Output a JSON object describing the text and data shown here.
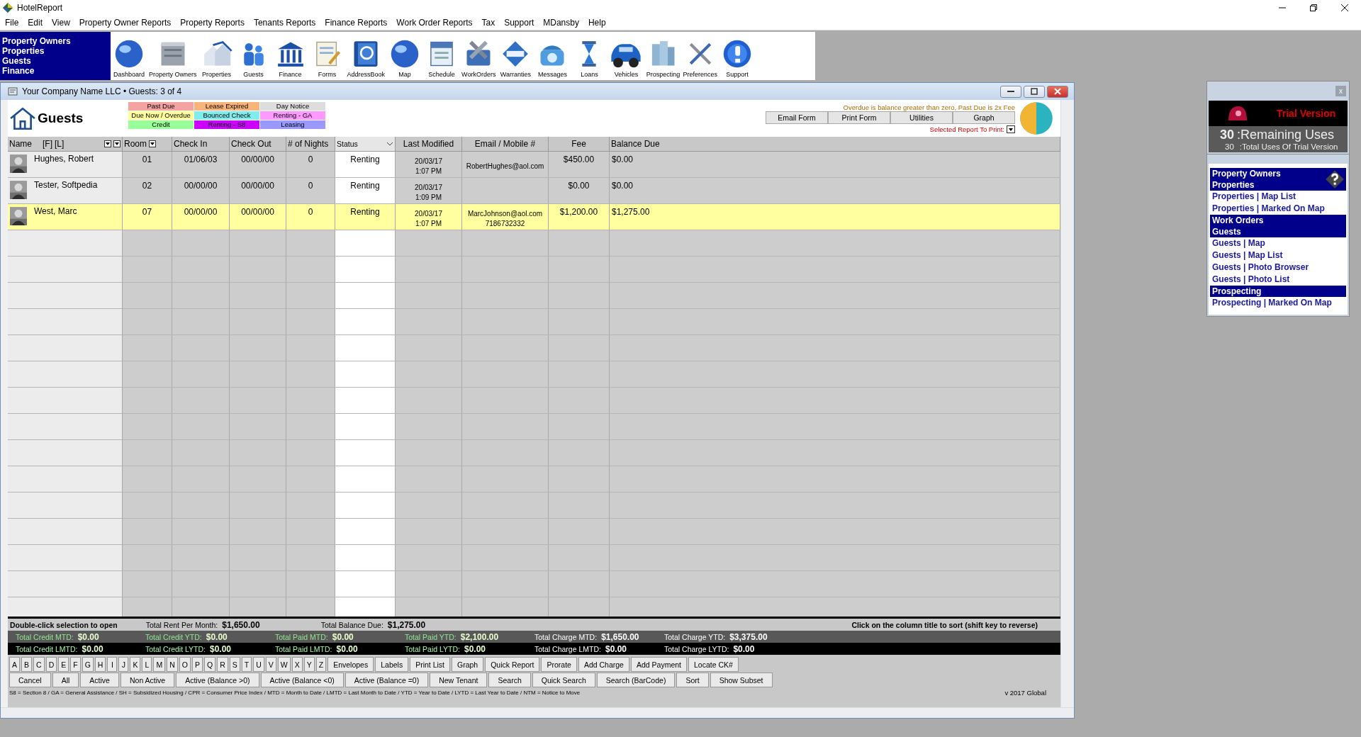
{
  "app_window": {
    "title": "HotelReport"
  },
  "menu": [
    "File",
    "Edit",
    "View",
    "Property Owner Reports",
    "Property Reports",
    "Tenants Reports",
    "Finance Reports",
    "Work Order Reports",
    "Tax",
    "Support",
    "MDansby",
    "Help"
  ],
  "toolbar": {
    "side_links": [
      "Property Owners",
      "Properties",
      "Guests",
      "Finance"
    ],
    "buttons": [
      "Dashboard",
      "Property Owners",
      "Properties",
      "Guests",
      "Finance",
      "Forms",
      "AddressBook",
      "Map",
      "Schedule",
      "WorkOrders",
      "Warranties",
      "Messages",
      "Loans",
      "Vehicles",
      "Prospecting",
      "Preferences",
      "Support"
    ]
  },
  "guests_window": {
    "title": "Your Company Name LLC  •  Guests: 3 of 4",
    "heading": "Guests",
    "legend": [
      {
        "label": "Past Due",
        "color": "#f4a3a3"
      },
      {
        "label": "Lease Expired",
        "color": "#f8b47a"
      },
      {
        "label": "Day Notice",
        "color": "#dddddd"
      },
      {
        "label": "Due Now / Overdue",
        "color": "#ffff99"
      },
      {
        "label": "Bounced Check",
        "color": "#80ecec"
      },
      {
        "label": "Renting - GA",
        "color": "#ff99ff"
      },
      {
        "label": "Credit",
        "color": "#99ff99"
      },
      {
        "label": "Renting - S8",
        "color": "#cc00ff"
      },
      {
        "label": "Leasing",
        "color": "#9999ff"
      }
    ],
    "note": "Overdue is balance greater than zero, Past Due is 2x Fee",
    "actions": [
      "Email Form",
      "Print Form",
      "Utilities",
      "Graph"
    ],
    "report_label": "Selected Report To Print:",
    "columns": {
      "name": "Name",
      "first": "[F]",
      "last": "[L]",
      "room": "Room",
      "check_in": "Check In",
      "check_out": "Check Out",
      "nights": "# of Nights",
      "status": "Status",
      "modified": "Last Modified",
      "email": "Email / Mobile #",
      "fee": "Fee",
      "balance": "Balance Due"
    },
    "rows": [
      {
        "name": "Hughes, Robert",
        "room": "01",
        "check_in": "01/06/03",
        "check_out": "00/00/00",
        "nights": "0",
        "status": "Renting",
        "date": "20/03/17",
        "time": "1:07 PM",
        "email": "RobertHughes@aol.com",
        "fee": "$450.00",
        "balance": "$0.00",
        "selected": false
      },
      {
        "name": "Tester, Softpedia",
        "room": "02",
        "check_in": "00/00/00",
        "check_out": "00/00/00",
        "nights": "0",
        "status": "Renting",
        "date": "20/03/17",
        "time": "1:09 PM",
        "fee": "$0.00",
        "balance": "$0.00",
        "selected": false
      },
      {
        "name": "West, Marc",
        "room": "07",
        "check_in": "00/00/00",
        "check_out": "00/00/00",
        "nights": "0",
        "status": "Renting",
        "date": "20/03/17",
        "time": "1:07 PM",
        "email": "MarcJohnson@aol.com",
        "phone": "7186732332",
        "fee": "$1,200.00",
        "balance": "$1,275.00",
        "selected": true
      }
    ],
    "summary": {
      "hint": "Double-click selection to open",
      "rent_label": "Total Rent Per Month:",
      "rent": "$1,650.00",
      "due_label": "Total Balance Due:",
      "due": "$1,275.00",
      "sort_hint": "Click on the column title to sort (shift key to reverse)"
    },
    "totals_current": [
      {
        "label": "Total Credit MTD:",
        "value": "$0.00"
      },
      {
        "label": "Total Credit YTD:",
        "value": "$0.00"
      },
      {
        "label": "Total Paid MTD:",
        "value": "$0.00"
      },
      {
        "label": "Total Paid YTD:",
        "value": "$2,100.00"
      },
      {
        "label": "Total Charge MTD:",
        "value": "$1,650.00"
      },
      {
        "label": "Total Charge YTD:",
        "value": "$3,375.00"
      }
    ],
    "totals_last": [
      {
        "label": "Total Credit LMTD:",
        "value": "$0.00"
      },
      {
        "label": "Total Credit LYTD:",
        "value": "$0.00"
      },
      {
        "label": "Total Paid LMTD:",
        "value": "$0.00"
      },
      {
        "label": "Total Paid LYTD:",
        "value": "$0.00"
      },
      {
        "label": "Total Charge LMTD:",
        "value": "$0.00"
      },
      {
        "label": "Total Charge LYTD:",
        "value": "$0.00"
      }
    ],
    "letters": [
      "A",
      "B",
      "C",
      "D",
      "E",
      "F",
      "G",
      "H",
      "I",
      "J",
      "K",
      "L",
      "M",
      "N",
      "O",
      "P",
      "Q",
      "R",
      "S",
      "T",
      "U",
      "V",
      "W",
      "X",
      "Y",
      "Z"
    ],
    "buttons_row1": [
      "Envelopes",
      "Labels",
      "Print List",
      "Graph",
      "Quick Report",
      "Prorate",
      "Add Charge",
      "Add Payment",
      "Locate CK#"
    ],
    "buttons_row2": [
      "Cancel",
      "All",
      "Active",
      "Non Active",
      "Active (Balance >0)",
      "Active (Balance <0)",
      "Active (Balance =0)",
      "New Tenant",
      "Search",
      "Quick Search",
      "Search (BarCode)",
      "Sort",
      "Show Subset"
    ],
    "abbreviations": "S8 = Section 8  /  GA = General Assistance  /  SH = Subsidized Housing  /  CPR = Consumer Price Index  /  MTD = Month to Date  /  LMTD = Last Month to Date  /  YTD = Year to Date  /  LYTD = Last Year to Date  /  NTM = Notice to Move",
    "version": "v 2017 Global"
  },
  "trial_panel": {
    "close": "x",
    "title": "Trial Version",
    "remaining": "30",
    "remaining_label": ":Remaining Uses",
    "total": "30",
    "total_label": ":Total Uses Of Trial Version"
  },
  "nav_panel": {
    "sections": [
      {
        "headers": [
          "Property Owners",
          "Properties"
        ],
        "links": [
          "Properties | Map List",
          "Properties | Marked On Map"
        ]
      },
      {
        "headers": [
          "Work Orders",
          "Guests"
        ],
        "links": [
          "Guests | Map",
          "Guests | Map List",
          "Guests | Photo Browser",
          "Guests | Photo List"
        ]
      },
      {
        "headers": [
          "Prospecting"
        ],
        "links": [
          "Prospecting | Marked On Map"
        ]
      }
    ]
  }
}
